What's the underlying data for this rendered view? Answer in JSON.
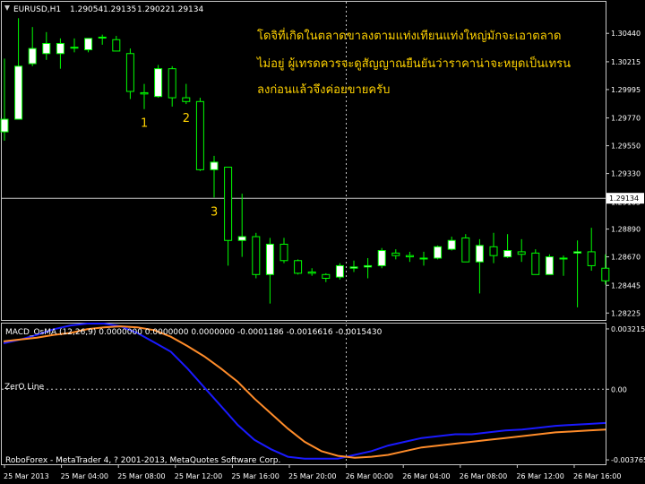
{
  "colors": {
    "background": "#000000",
    "frame": "#c8c8c8",
    "bull_candle": "#ffffff",
    "bear_candle": "#000000",
    "wick": "#00ff00",
    "macd_line": "#1a1aff",
    "signal_line": "#ff8c2a",
    "annotation": "#ffd200",
    "crosshair": "#c8c8c8"
  },
  "header": {
    "symbol": "EURUSD,H1",
    "open": "1.29054",
    "high": "1.29135",
    "low": "1.29022",
    "close": "1.29134"
  },
  "annotation_lines": [
    "โดจิที่เกิดในตลาดขาลงตามแท่งเทียนแท่งใหญ่มักจะเอาตลาด",
    "ไม่อยู่ ผู้เทรดควรจะดูสัญญาณยืนยันว่าราคาน่าจะหยุดเป็นเทรน",
    "ลงก่อนแล้วจึงค่อยขายครับ"
  ],
  "markers": [
    {
      "text": "1",
      "candle": 10
    },
    {
      "text": "2",
      "candle": 13
    },
    {
      "text": "3",
      "candle": 15
    }
  ],
  "indicator": {
    "title": "MACD_OsMA (12,26,9) 0.0000000 0.0000000 0.0000000 -0.0001186 -0.0016616 -0.0015430",
    "zero_label": "ZerO Line",
    "footer": "RoboForex - MetaTrader 4, ? 2001-2013, MetaQuotes Software Corp."
  },
  "chart_data": [
    {
      "type": "candlestick",
      "title": "EURUSD,H1",
      "ylim": [
        1.2817,
        1.3069
      ],
      "ticks": [
        "1.30440",
        "1.30215",
        "1.29995",
        "1.29770",
        "1.29550",
        "1.29330",
        "1.29105",
        "1.28890",
        "1.28670",
        "1.28445",
        "1.28225"
      ],
      "tick_values": [
        1.3044,
        1.30215,
        1.29995,
        1.2977,
        1.2955,
        1.2933,
        1.29105,
        1.2889,
        1.2867,
        1.28445,
        1.28225
      ],
      "current_price": "1.29134",
      "current_value": 1.29134,
      "candles": [
        {
          "o": 1.2966,
          "h": 1.3024,
          "l": 1.2959,
          "c": 1.2976
        },
        {
          "o": 1.2976,
          "h": 1.3056,
          "l": 1.2976,
          "c": 1.3018
        },
        {
          "o": 1.302,
          "h": 1.3049,
          "l": 1.3018,
          "c": 1.3032
        },
        {
          "o": 1.3028,
          "h": 1.3045,
          "l": 1.3023,
          "c": 1.3036
        },
        {
          "o": 1.3028,
          "h": 1.304,
          "l": 1.3016,
          "c": 1.3036
        },
        {
          "o": 1.3033,
          "h": 1.304,
          "l": 1.3029,
          "c": 1.3033
        },
        {
          "o": 1.3031,
          "h": 1.304,
          "l": 1.3029,
          "c": 1.304
        },
        {
          "o": 1.3041,
          "h": 1.3043,
          "l": 1.3035,
          "c": 1.3041
        },
        {
          "o": 1.3039,
          "h": 1.3042,
          "l": 1.303,
          "c": 1.303
        },
        {
          "o": 1.3028,
          "h": 1.3032,
          "l": 1.2992,
          "c": 1.2998
        },
        {
          "o": 1.2997,
          "h": 1.3004,
          "l": 1.2984,
          "c": 1.2996
        },
        {
          "o": 1.2994,
          "h": 1.3019,
          "l": 1.2993,
          "c": 1.3016
        },
        {
          "o": 1.3016,
          "h": 1.3018,
          "l": 1.2986,
          "c": 1.2993
        },
        {
          "o": 1.2993,
          "h": 1.3004,
          "l": 1.2988,
          "c": 1.299
        },
        {
          "o": 1.299,
          "h": 1.2993,
          "l": 1.2935,
          "c": 1.2936
        },
        {
          "o": 1.2936,
          "h": 1.2947,
          "l": 1.2914,
          "c": 1.2942
        },
        {
          "o": 1.2938,
          "h": 1.2938,
          "l": 1.286,
          "c": 1.288
        },
        {
          "o": 1.288,
          "h": 1.2917,
          "l": 1.2867,
          "c": 1.2883
        },
        {
          "o": 1.2883,
          "h": 1.2886,
          "l": 1.285,
          "c": 1.2853
        },
        {
          "o": 1.2853,
          "h": 1.2882,
          "l": 1.283,
          "c": 1.2877
        },
        {
          "o": 1.2877,
          "h": 1.2882,
          "l": 1.2862,
          "c": 1.2864
        },
        {
          "o": 1.2864,
          "h": 1.2865,
          "l": 1.2853,
          "c": 1.2854
        },
        {
          "o": 1.2855,
          "h": 1.2858,
          "l": 1.2852,
          "c": 1.2854
        },
        {
          "o": 1.2853,
          "h": 1.2854,
          "l": 1.2847,
          "c": 1.285
        },
        {
          "o": 1.2851,
          "h": 1.2862,
          "l": 1.2849,
          "c": 1.286
        },
        {
          "o": 1.2858,
          "h": 1.2864,
          "l": 1.2855,
          "c": 1.2859
        },
        {
          "o": 1.2859,
          "h": 1.2866,
          "l": 1.285,
          "c": 1.286
        },
        {
          "o": 1.286,
          "h": 1.2874,
          "l": 1.2858,
          "c": 1.2872
        },
        {
          "o": 1.287,
          "h": 1.2873,
          "l": 1.2865,
          "c": 1.2868
        },
        {
          "o": 1.2868,
          "h": 1.2871,
          "l": 1.2863,
          "c": 1.2867
        },
        {
          "o": 1.2866,
          "h": 1.2871,
          "l": 1.286,
          "c": 1.2866
        },
        {
          "o": 1.2866,
          "h": 1.2876,
          "l": 1.2865,
          "c": 1.2875
        },
        {
          "o": 1.2873,
          "h": 1.2883,
          "l": 1.2872,
          "c": 1.288
        },
        {
          "o": 1.2882,
          "h": 1.2885,
          "l": 1.2863,
          "c": 1.2863
        },
        {
          "o": 1.2863,
          "h": 1.2881,
          "l": 1.2838,
          "c": 1.2876
        },
        {
          "o": 1.2875,
          "h": 1.2886,
          "l": 1.2862,
          "c": 1.2868
        },
        {
          "o": 1.2867,
          "h": 1.2885,
          "l": 1.2866,
          "c": 1.2872
        },
        {
          "o": 1.2871,
          "h": 1.2881,
          "l": 1.2863,
          "c": 1.2869
        },
        {
          "o": 1.287,
          "h": 1.2873,
          "l": 1.2853,
          "c": 1.2853
        },
        {
          "o": 1.2853,
          "h": 1.2869,
          "l": 1.2853,
          "c": 1.2867
        },
        {
          "o": 1.2866,
          "h": 1.2868,
          "l": 1.2852,
          "c": 1.2866
        },
        {
          "o": 1.287,
          "h": 1.288,
          "l": 1.2827,
          "c": 1.2871
        },
        {
          "o": 1.2871,
          "h": 1.289,
          "l": 1.2856,
          "c": 1.286
        },
        {
          "o": 1.2858,
          "h": 1.2869,
          "l": 1.2845,
          "c": 1.2848
        }
      ]
    },
    {
      "type": "line",
      "title": "MACD_OsMA (12,26,9)",
      "ylim": [
        -0.004,
        0.0035
      ],
      "ticks": [
        "0.003215",
        "0.00",
        "-0.003765"
      ],
      "tick_values": [
        0.003215,
        0.0,
        -0.003765
      ],
      "zero_line": 0.0,
      "series": [
        {
          "name": "MACD",
          "values": [
            0.00245,
            0.00265,
            0.0029,
            0.0032,
            0.0034,
            0.0035,
            0.0035,
            0.00335,
            0.003,
            0.0025,
            0.002,
            0.0011,
            0.0001,
            -0.0009,
            -0.0019,
            -0.0027,
            -0.0032,
            -0.0036,
            -0.0037,
            -0.0037,
            -0.0037,
            -0.0035,
            -0.0033,
            -0.003,
            -0.0028,
            -0.0026,
            -0.0025,
            -0.0024,
            -0.0024,
            -0.0023,
            -0.0022,
            -0.00215,
            -0.00205,
            -0.00195,
            -0.0019,
            -0.00185,
            -0.0018
          ]
        },
        {
          "name": "Signal",
          "values": [
            0.00255,
            0.00265,
            0.00275,
            0.0029,
            0.003,
            0.0032,
            0.0033,
            0.00335,
            0.0033,
            0.00315,
            0.0028,
            0.0023,
            0.00175,
            0.0011,
            0.0004,
            -0.0005,
            -0.0013,
            -0.0021,
            -0.0028,
            -0.0033,
            -0.00355,
            -0.00365,
            -0.0036,
            -0.0035,
            -0.0033,
            -0.0031,
            -0.003,
            -0.0029,
            -0.0028,
            -0.0027,
            -0.0026,
            -0.0025,
            -0.0024,
            -0.0023,
            -0.00225,
            -0.0022,
            -0.00215
          ]
        }
      ]
    }
  ],
  "x_axis": {
    "labels": [
      "25 Mar 2013",
      "25 Mar 04:00",
      "25 Mar 08:00",
      "25 Mar 12:00",
      "25 Mar 16:00",
      "25 Mar 20:00",
      "26 Mar 00:00",
      "26 Mar 04:00",
      "26 Mar 08:00",
      "26 Mar 12:00",
      "26 Mar 16:00"
    ]
  }
}
